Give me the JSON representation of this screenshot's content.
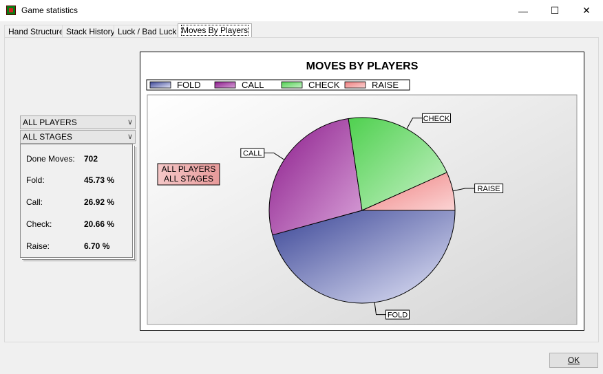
{
  "window": {
    "title": "Game statistics",
    "minimize_glyph": "—",
    "maximize_glyph": "☐",
    "close_glyph": "✕"
  },
  "tabs": [
    {
      "label": "Hand Structure",
      "active": false
    },
    {
      "label": "Stack History",
      "active": false
    },
    {
      "label": "Luck / Bad Luck",
      "active": false
    },
    {
      "label": "Moves By Players",
      "active": true
    }
  ],
  "filters": {
    "player": "ALL PLAYERS",
    "stage": "ALL STAGES"
  },
  "stats": [
    {
      "label": "Done Moves:",
      "value": "702"
    },
    {
      "label": "Fold:",
      "value": "45.73 %"
    },
    {
      "label": "Call:",
      "value": "26.92 %"
    },
    {
      "label": "Check:",
      "value": "20.66 %"
    },
    {
      "label": "Raise:",
      "value": "6.70 %"
    }
  ],
  "ok_label": "OK",
  "colors": {
    "fold": "#5a62a8",
    "call": "#9a2a98",
    "check": "#6fd86f",
    "raise": "#f29a9a"
  },
  "chart_data": {
    "type": "pie",
    "title": "MOVES BY PLAYERS",
    "annotation": [
      "ALL PLAYERS",
      "ALL STAGES"
    ],
    "legend_position": "top",
    "categories": [
      "FOLD",
      "CALL",
      "CHECK",
      "RAISE"
    ],
    "values": [
      45.73,
      26.92,
      20.66,
      6.7
    ]
  }
}
